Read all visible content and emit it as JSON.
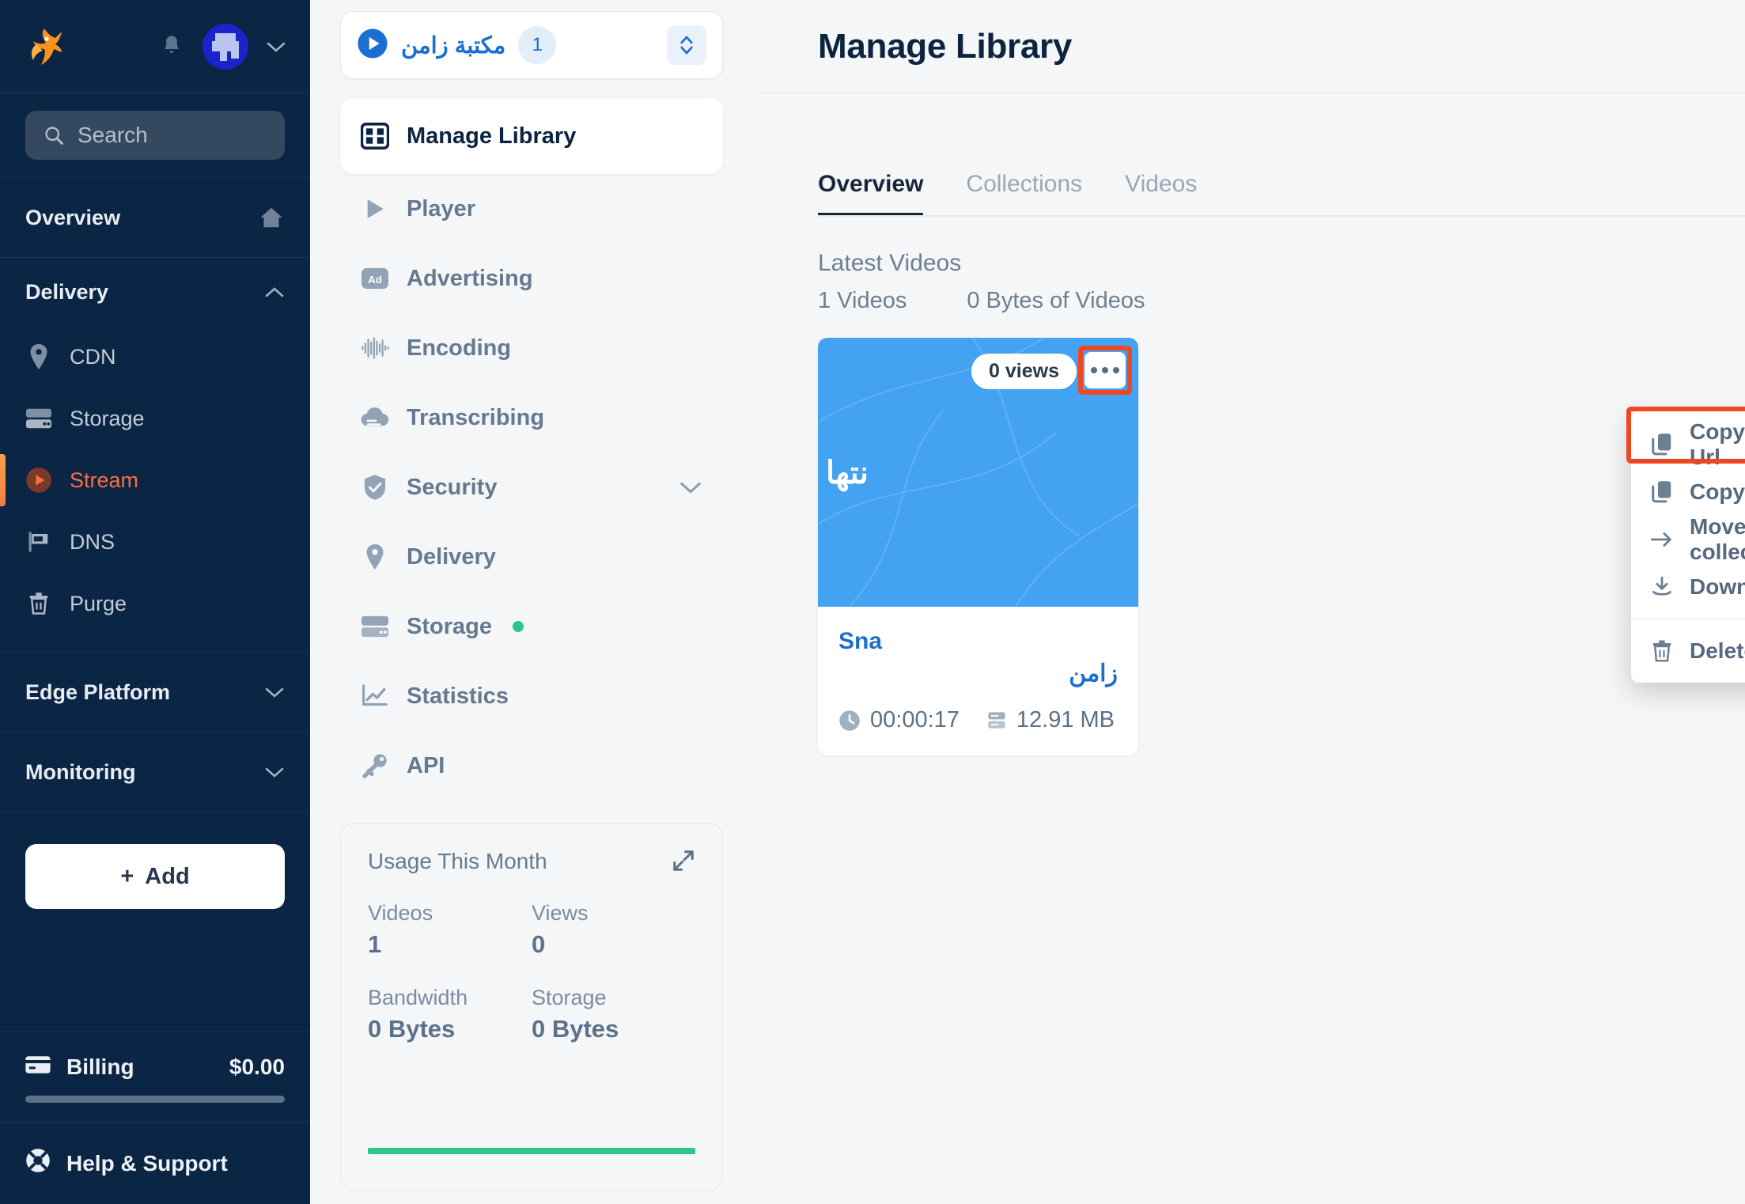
{
  "sidebar": {
    "logo": "bunny-logo",
    "notifications_icon": "bell-icon",
    "avatar_icon": "user-avatar",
    "account_chevron_icon": "chevron-down-icon",
    "search": {
      "placeholder": "Search",
      "icon": "search-icon"
    },
    "overview": {
      "label": "Overview",
      "icon": "home-icon"
    },
    "delivery": {
      "label": "Delivery",
      "chevron": "chevron-up-icon",
      "items": [
        {
          "label": "CDN",
          "icon": "pin-icon",
          "active": false
        },
        {
          "label": "Storage",
          "icon": "drive-icon",
          "active": false
        },
        {
          "label": "Stream",
          "icon": "play-circle-icon",
          "active": true
        },
        {
          "label": "DNS",
          "icon": "flag-icon",
          "active": false
        },
        {
          "label": "Purge",
          "icon": "trash-icon",
          "active": false
        }
      ]
    },
    "edge_platform": {
      "label": "Edge Platform",
      "chevron": "chevron-down-icon"
    },
    "monitoring": {
      "label": "Monitoring",
      "chevron": "chevron-down-icon"
    },
    "add_button": {
      "label": "Add",
      "plus": "+"
    },
    "billing": {
      "label": "Billing",
      "amount": "$0.00",
      "icon": "credit-card-icon"
    },
    "help": {
      "label": "Help & Support",
      "icon": "lifebuoy-icon"
    }
  },
  "midpanel": {
    "library_selector": {
      "icon": "play-circle-icon",
      "name": "مكتبة زامن",
      "badge": "1",
      "updown_icon": "chevron-up-down-icon"
    },
    "nav": [
      {
        "label": "Manage Library",
        "icon": "film-icon",
        "active": true
      },
      {
        "label": "Player",
        "icon": "play-icon",
        "active": false
      },
      {
        "label": "Advertising",
        "icon": "ad-icon",
        "active": false
      },
      {
        "label": "Encoding",
        "icon": "waveform-icon",
        "active": false
      },
      {
        "label": "Transcribing",
        "icon": "cloud-icon",
        "active": false
      },
      {
        "label": "Security",
        "icon": "shield-check-icon",
        "active": false,
        "chevron": "chevron-down-icon"
      },
      {
        "label": "Delivery",
        "icon": "pin-icon",
        "active": false
      },
      {
        "label": "Storage",
        "icon": "drive-icon",
        "active": false,
        "status_dot": "#2dc58a"
      },
      {
        "label": "Statistics",
        "icon": "chart-line-icon",
        "active": false
      },
      {
        "label": "API",
        "icon": "key-icon",
        "active": false
      }
    ],
    "usage": {
      "title": "Usage This Month",
      "expand_icon": "expand-icon",
      "stats": [
        {
          "label": "Videos",
          "value": "1"
        },
        {
          "label": "Views",
          "value": "0"
        },
        {
          "label": "Bandwidth",
          "value": "0 Bytes"
        },
        {
          "label": "Storage",
          "value": "0 Bytes"
        }
      ],
      "progress_color": "#2dc58a"
    }
  },
  "main": {
    "title": "Manage Library",
    "tabs": [
      {
        "label": "Overview",
        "active": true
      },
      {
        "label": "Collections",
        "active": false
      },
      {
        "label": "Videos",
        "active": false
      }
    ],
    "latest": {
      "heading": "Latest Videos",
      "count": "1 Videos",
      "size": "0 Bytes of Videos"
    },
    "video_card": {
      "views": "0 views",
      "more_icon": "ellipsis-icon",
      "thumbnail_text": "نتها",
      "title_line1": "Sna",
      "title_line2": "زامن",
      "duration": "00:00:17",
      "duration_icon": "clock-icon",
      "size": "12.91 MB",
      "size_icon": "drive-icon"
    },
    "context_menu": {
      "items": [
        {
          "label": "Copy Video Play Url",
          "icon": "copy-icon",
          "highlighted": true
        },
        {
          "label": "Copy Video ID",
          "icon": "copy-icon",
          "highlighted": false
        },
        {
          "label": "Move to collection",
          "icon": "arrow-right-icon",
          "highlighted": false
        },
        {
          "label": "Download",
          "icon": "download-icon",
          "highlighted": false
        },
        {
          "label": "Delete",
          "icon": "trash-icon",
          "highlighted": false
        }
      ]
    },
    "annotation_color": "#ee4823"
  }
}
